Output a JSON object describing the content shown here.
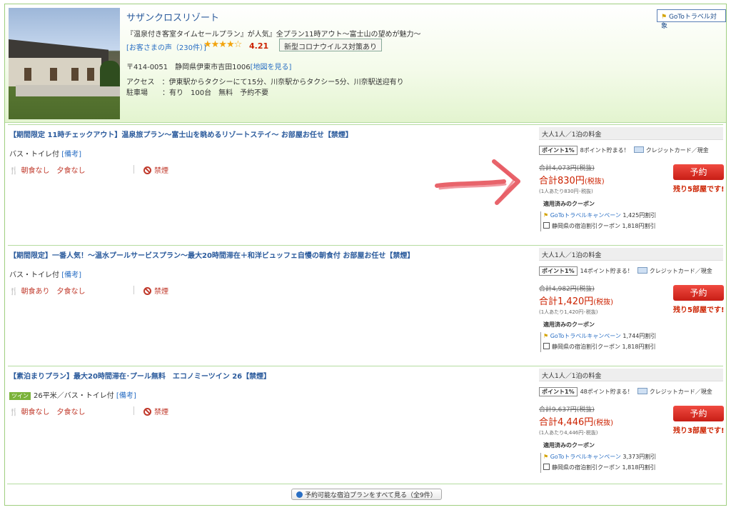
{
  "hotel": {
    "name": "サザンクロスリゾート",
    "catch": "『温泉付き客室タイムセールプラン』が人気』全プラン11時アウト〜富士山の望めが魅力〜",
    "reviews_link": "[お客さまの声（230件）]",
    "stars": "★★★★☆",
    "score": "4.21",
    "covid_badge": "新型コロナウイルス対策あり",
    "address": "〒414-0051　静岡県伊東市吉田1006",
    "map_link": "[地図を見る]",
    "access": "アクセス　：伊東駅からタクシーにて15分、川奈駅からタクシー5分、川奈駅送迎有り",
    "parking": "駐車場　　：有り　100台　無料　予約不要",
    "goto_badge": "GoToトラベル対象"
  },
  "plans": [
    {
      "title": "【期間限定 11時チェックアウト】温泉旅プラン〜富士山を眺めるリゾートステイ〜 お部屋お任せ【禁煙】",
      "tag": "",
      "sub": "バス・トイレ付",
      "note": "[備考]",
      "meal": "朝食なし　夕食なし",
      "smoke": "禁煙",
      "price_head": "大人1人／1泊の料金",
      "points_badge": "ポイント1%",
      "points_text": "8ポイント貯まる！",
      "payment": "クレジットカード／現金",
      "old_price": "合計4,073円(税抜)",
      "total_label": "合計",
      "total_amount": "830円",
      "total_tax": "(税抜)",
      "per": "(1人あたり830円･税抜)",
      "coupon_head": "適用済みのクーポン",
      "goto_coupon": "GoToトラベルキャンペーン",
      "goto_discount": "1,425円割引",
      "pref_coupon": "静岡県の宿泊割引クーポン",
      "pref_discount": "1,818円割引",
      "book": "予約",
      "rooms_left": "残り5部屋です!"
    },
    {
      "title": "【期間限定】一番人気！〜温水プールサービスプラン〜最大20時間滞在＋和洋ビュッフェ自慢の朝食付 お部屋お任せ【禁煙】",
      "tag": "",
      "sub": "バス・トイレ付",
      "note": "[備考]",
      "meal": "朝食あり　夕食なし",
      "smoke": "禁煙",
      "price_head": "大人1人／1泊の料金",
      "points_badge": "ポイント1%",
      "points_text": "14ポイント貯まる！",
      "payment": "クレジットカード／現金",
      "old_price": "合計4,982円(税抜)",
      "total_label": "合計",
      "total_amount": "1,420円",
      "total_tax": "(税抜)",
      "per": "(1人あたり1,420円･税抜)",
      "coupon_head": "適用済みのクーポン",
      "goto_coupon": "GoToトラベルキャンペーン",
      "goto_discount": "1,744円割引",
      "pref_coupon": "静岡県の宿泊割引クーポン",
      "pref_discount": "1,818円割引",
      "book": "予約",
      "rooms_left": "残り5部屋です!"
    },
    {
      "title": "【素泊まりプラン】最大20時間滞在･プール無料　エコノミーツイン 26【禁煙】",
      "tag": "ツイン",
      "sub": "26平米／バス・トイレ付",
      "note": "[備考]",
      "meal": "朝食なし　夕食なし",
      "smoke": "禁煙",
      "price_head": "大人1人／1泊の料金",
      "points_badge": "ポイント1%",
      "points_text": "48ポイント貯まる！",
      "payment": "クレジットカード／現金",
      "old_price": "合計9,637円(税抜)",
      "total_label": "合計",
      "total_amount": "4,446円",
      "total_tax": "(税抜)",
      "per": "(1人あたり4,446円･税抜)",
      "coupon_head": "適用済みのクーポン",
      "goto_coupon": "GoToトラベルキャンペーン",
      "goto_discount": "3,373円割引",
      "pref_coupon": "静岡県の宿泊割引クーポン",
      "pref_discount": "1,818円割引",
      "book": "予約",
      "rooms_left": "残り3部屋です!"
    }
  ],
  "more_button": "予約可能な宿泊プランをすべて見る（全9件）",
  "colors": {
    "accent_green": "#9fcf7f",
    "price_red": "#cc2200",
    "link_blue": "#2a6fc4",
    "book_red": "#e0312a"
  }
}
